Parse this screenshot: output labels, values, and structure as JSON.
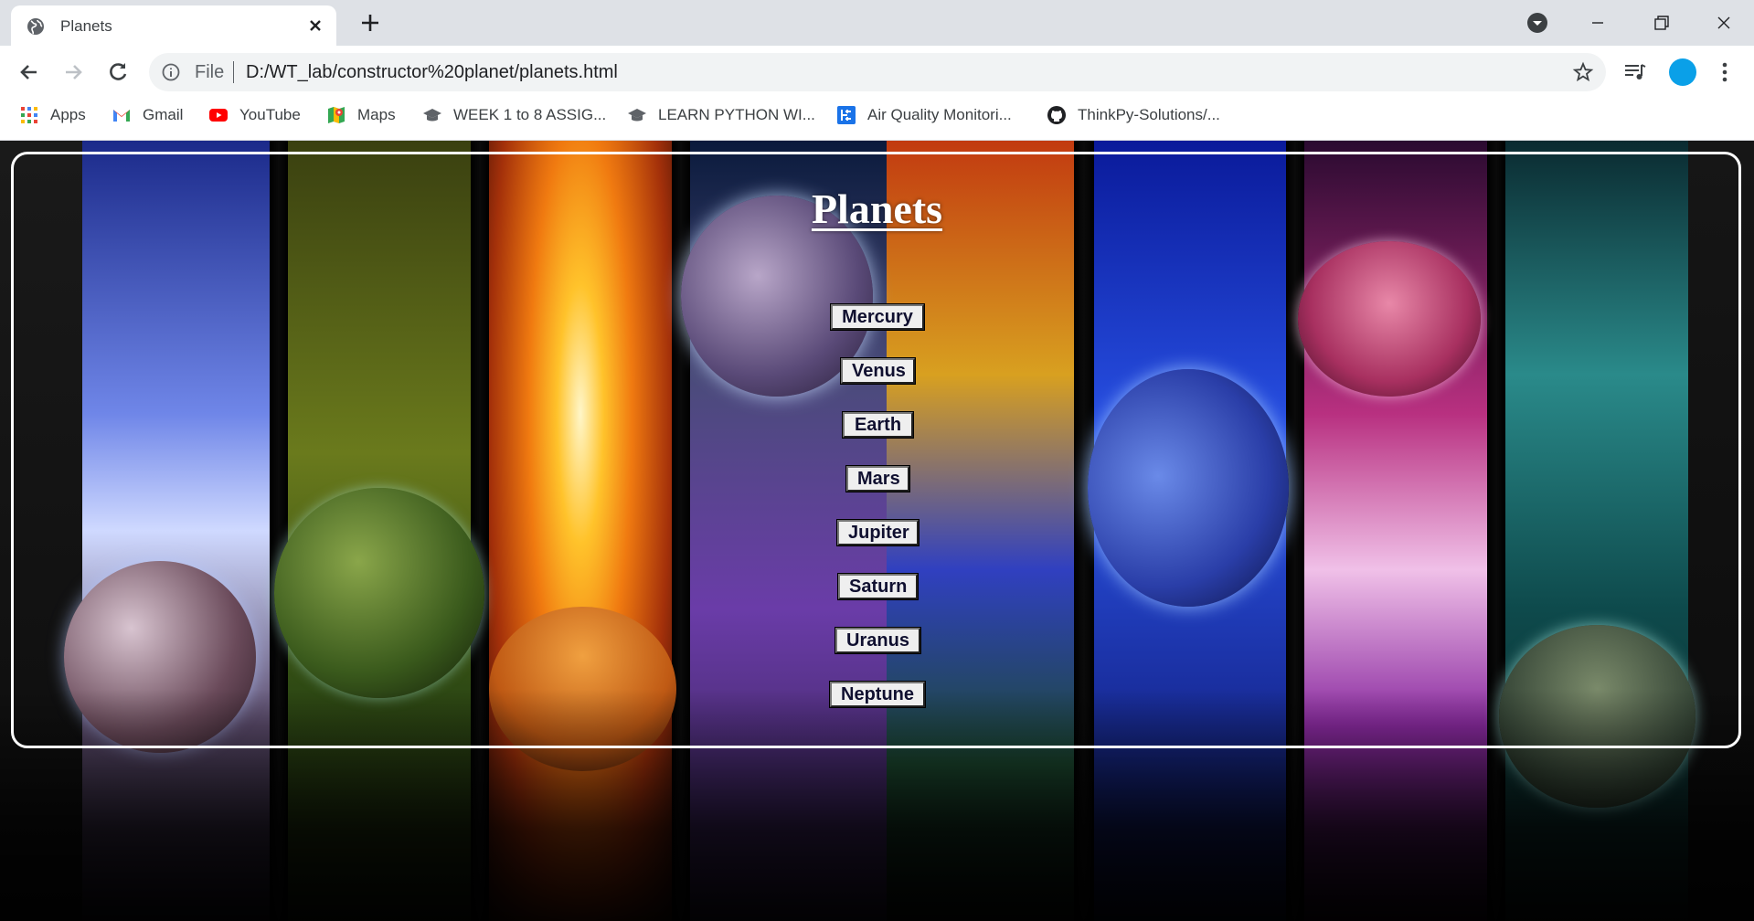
{
  "browser": {
    "tab_title": "Planets",
    "address_scheme": "File",
    "address_url": "D:/WT_lab/constructor%20planet/planets.html",
    "accent_colors": {
      "avatar": "#0aa0e8",
      "tabstrip": "#dee1e6"
    }
  },
  "bookmarks": [
    {
      "label": "Apps",
      "icon": "apps-grid-icon"
    },
    {
      "label": "Gmail",
      "icon": "gmail-icon"
    },
    {
      "label": "YouTube",
      "icon": "youtube-icon"
    },
    {
      "label": "Maps",
      "icon": "maps-icon"
    },
    {
      "label": "WEEK 1 to 8 ASSIG...",
      "icon": "classroom-cap-icon"
    },
    {
      "label": "LEARN PYTHON WI...",
      "icon": "classroom-cap-icon"
    },
    {
      "label": "Air Quality Monitori...",
      "icon": "air-quality-icon"
    },
    {
      "label": "ThinkPy-Solutions/...",
      "icon": "github-icon"
    }
  ],
  "page": {
    "title": "Planets",
    "buttons": [
      "Mercury",
      "Venus",
      "Earth",
      "Mars",
      "Jupiter",
      "Saturn",
      "Uranus",
      "Neptune"
    ]
  }
}
